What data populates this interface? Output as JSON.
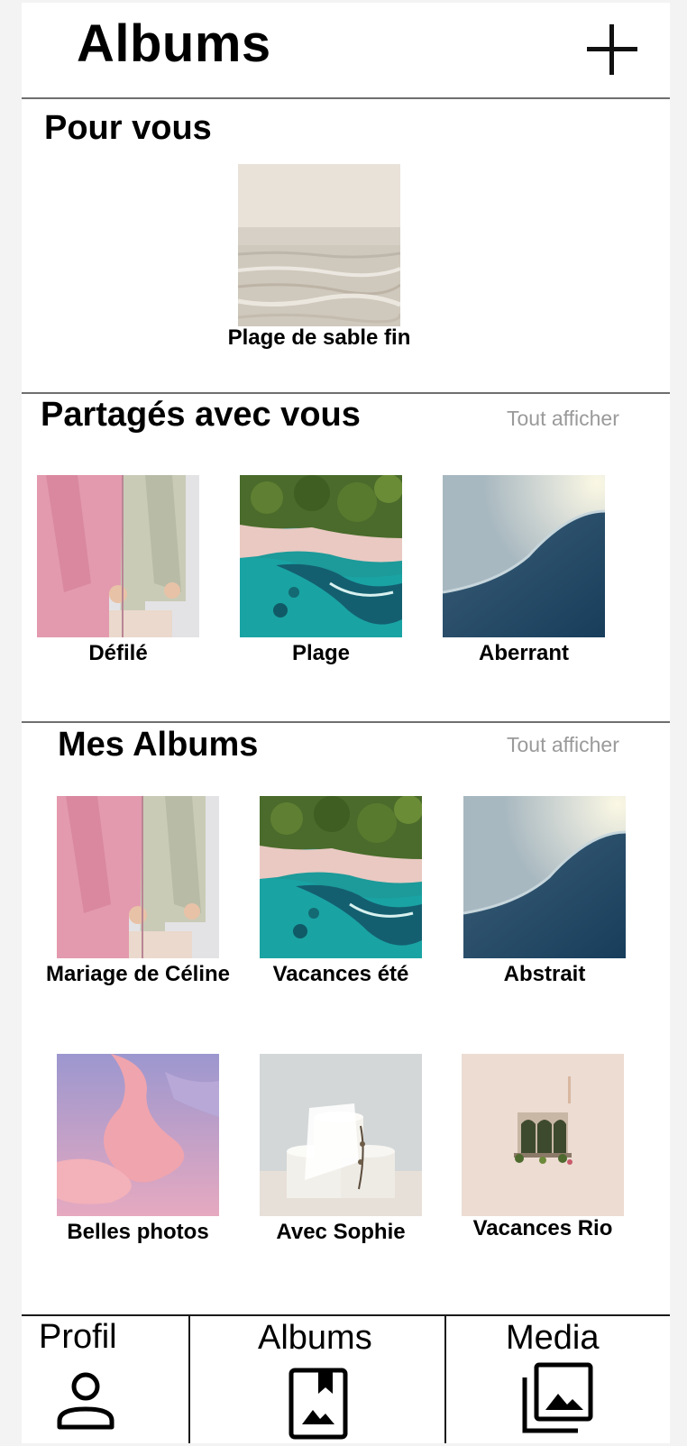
{
  "header": {
    "title": "Albums",
    "add_icon": "plus-icon"
  },
  "for_you": {
    "title": "Pour vous",
    "items": [
      {
        "label": "Plage de sable fin",
        "image": "calm-sea-shore"
      }
    ]
  },
  "shared": {
    "title": "Partagés avec vous",
    "see_all": "Tout afficher",
    "items": [
      {
        "label": "Défilé",
        "image": "pink-and-sage-suits"
      },
      {
        "label": "Plage",
        "image": "aerial-tropical-beach"
      },
      {
        "label": "Aberrant",
        "image": "abstract-blue-curve"
      }
    ]
  },
  "my_albums": {
    "title": "Mes Albums",
    "see_all": "Tout afficher",
    "items": [
      {
        "label": "Mariage de Céline",
        "image": "pink-and-sage-suits"
      },
      {
        "label": "Vacances été",
        "image": "aerial-tropical-beach"
      },
      {
        "label": "Abstrait",
        "image": "abstract-blue-curve"
      },
      {
        "label": "Belles photos",
        "image": "pink-lilac-sky"
      },
      {
        "label": "Avec Sophie",
        "image": "paper-rolls"
      },
      {
        "label": "Vacances Rio",
        "image": "window-with-shutters"
      }
    ]
  },
  "tabbar": {
    "tabs": [
      {
        "label": "Profil",
        "icon": "person-icon"
      },
      {
        "label": "Albums",
        "icon": "album-icon"
      },
      {
        "label": "Media",
        "icon": "photo-library-icon"
      }
    ]
  },
  "colors": {
    "divider": "#6f6f6f",
    "muted_text": "#9a9a9a",
    "background": "#ffffff",
    "outer": "#f3f3f3"
  }
}
